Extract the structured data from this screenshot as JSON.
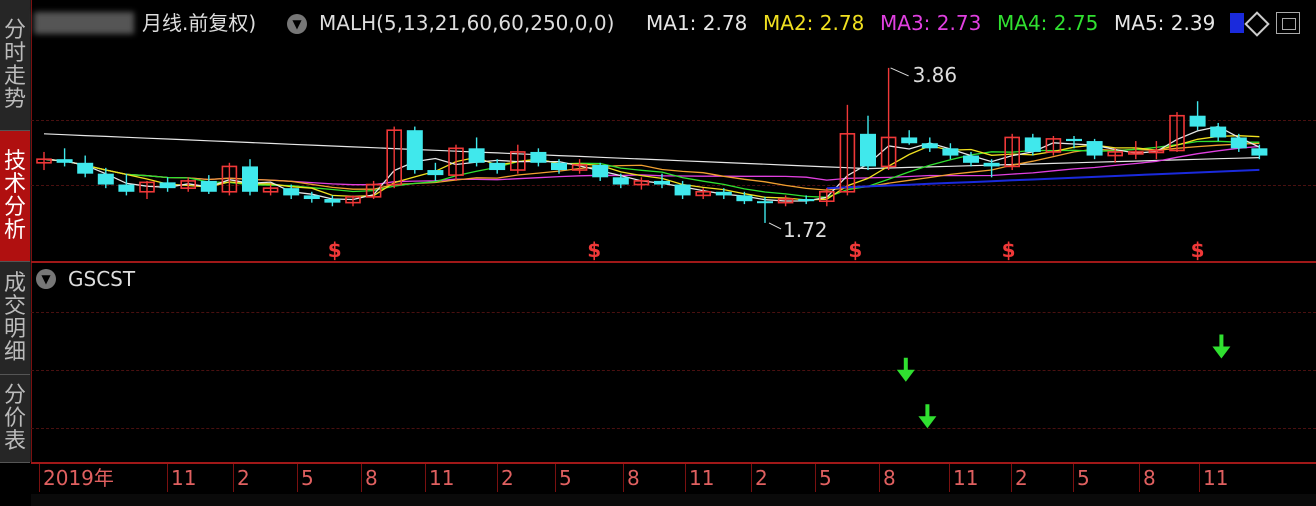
{
  "side_tabs": [
    {
      "label": "分时走势",
      "active": false
    },
    {
      "label": "技术分析",
      "active": true
    },
    {
      "label": "成交明细",
      "active": false
    },
    {
      "label": "分价表",
      "active": false
    }
  ],
  "header": {
    "period_label": "月线.前复权)",
    "indicator_params": "MALH(5,13,21,60,60,250,0,0)",
    "ma1": "MA1: 2.78",
    "ma2": "MA2: 2.78",
    "ma3": "MA3: 2.73",
    "ma4": "MA4: 2.75",
    "ma5": "MA5: 2.39"
  },
  "colors": {
    "up": "#f03838",
    "down": "#40e8ec",
    "ma1": "#e6e6e6",
    "ma2": "#f0e020",
    "ma3": "#e040e0",
    "ma4": "#30e030",
    "ma5": "#e6e6e6",
    "ma_blue": "#1a2adc",
    "ma_orange": "#f0a030",
    "signal": "#30e030"
  },
  "price_chart": {
    "high_label": "3.86",
    "low_label": "1.72",
    "signal_mark": "$"
  },
  "sub_chart": {
    "title": "GSCST"
  },
  "time_axis": {
    "labels": [
      "2019年",
      "11",
      "2",
      "5",
      "8",
      "11",
      "2",
      "5",
      "8",
      "11",
      "2",
      "5",
      "8",
      "11",
      "2",
      "5",
      "8",
      "11"
    ]
  },
  "chart_data": {
    "type": "candlestick",
    "ohlc": [
      [
        2.55,
        2.7,
        2.45,
        2.6
      ],
      [
        2.6,
        2.75,
        2.5,
        2.55
      ],
      [
        2.55,
        2.65,
        2.35,
        2.4
      ],
      [
        2.4,
        2.48,
        2.2,
        2.25
      ],
      [
        2.25,
        2.4,
        2.1,
        2.15
      ],
      [
        2.15,
        2.3,
        2.05,
        2.28
      ],
      [
        2.28,
        2.35,
        2.15,
        2.2
      ],
      [
        2.2,
        2.35,
        2.15,
        2.3
      ],
      [
        2.3,
        2.38,
        2.12,
        2.15
      ],
      [
        2.15,
        2.55,
        2.1,
        2.5
      ],
      [
        2.5,
        2.6,
        2.1,
        2.15
      ],
      [
        2.15,
        2.25,
        2.1,
        2.2
      ],
      [
        2.2,
        2.25,
        2.05,
        2.1
      ],
      [
        2.1,
        2.15,
        2.0,
        2.05
      ],
      [
        2.05,
        2.1,
        1.95,
        2.0
      ],
      [
        2.0,
        2.1,
        1.95,
        2.08
      ],
      [
        2.08,
        2.3,
        2.05,
        2.25
      ],
      [
        2.25,
        3.05,
        2.2,
        3.0
      ],
      [
        3.0,
        3.05,
        2.4,
        2.45
      ],
      [
        2.45,
        2.55,
        2.3,
        2.38
      ],
      [
        2.38,
        2.8,
        2.3,
        2.75
      ],
      [
        2.75,
        2.9,
        2.5,
        2.55
      ],
      [
        2.55,
        2.6,
        2.4,
        2.45
      ],
      [
        2.45,
        2.8,
        2.4,
        2.7
      ],
      [
        2.7,
        2.75,
        2.5,
        2.55
      ],
      [
        2.55,
        2.6,
        2.4,
        2.45
      ],
      [
        2.45,
        2.6,
        2.4,
        2.52
      ],
      [
        2.52,
        2.55,
        2.3,
        2.35
      ],
      [
        2.35,
        2.4,
        2.2,
        2.25
      ],
      [
        2.25,
        2.35,
        2.18,
        2.3
      ],
      [
        2.3,
        2.4,
        2.2,
        2.25
      ],
      [
        2.25,
        2.3,
        2.05,
        2.1
      ],
      [
        2.1,
        2.2,
        2.05,
        2.15
      ],
      [
        2.15,
        2.2,
        2.05,
        2.1
      ],
      [
        2.1,
        2.15,
        1.98,
        2.02
      ],
      [
        2.02,
        2.08,
        1.72,
        2.0
      ],
      [
        2.0,
        2.1,
        1.95,
        2.05
      ],
      [
        2.05,
        2.1,
        1.98,
        2.02
      ],
      [
        2.02,
        2.2,
        1.95,
        2.15
      ],
      [
        2.15,
        3.35,
        2.1,
        2.95
      ],
      [
        2.95,
        3.2,
        2.45,
        2.5
      ],
      [
        2.5,
        3.86,
        2.45,
        2.9
      ],
      [
        2.9,
        3.0,
        2.8,
        2.82
      ],
      [
        2.82,
        2.9,
        2.7,
        2.75
      ],
      [
        2.75,
        2.82,
        2.6,
        2.65
      ],
      [
        2.65,
        2.7,
        2.5,
        2.55
      ],
      [
        2.55,
        2.6,
        2.35,
        2.5
      ],
      [
        2.5,
        2.95,
        2.45,
        2.9
      ],
      [
        2.9,
        2.95,
        2.65,
        2.7
      ],
      [
        2.7,
        2.92,
        2.65,
        2.88
      ],
      [
        2.88,
        2.92,
        2.75,
        2.85
      ],
      [
        2.85,
        2.88,
        2.6,
        2.65
      ],
      [
        2.65,
        2.75,
        2.55,
        2.7
      ],
      [
        2.7,
        2.85,
        2.6,
        2.7
      ],
      [
        2.7,
        2.85,
        2.6,
        2.72
      ],
      [
        2.72,
        3.25,
        2.7,
        3.2
      ],
      [
        3.2,
        3.4,
        3.0,
        3.05
      ],
      [
        3.05,
        3.1,
        2.85,
        2.9
      ],
      [
        2.9,
        2.95,
        2.7,
        2.75
      ],
      [
        2.75,
        2.8,
        2.6,
        2.65
      ]
    ],
    "signal_bars": [
      8,
      17,
      29,
      41,
      56
    ],
    "sub_arrows": [
      {
        "bar": 48,
        "level": 0.55
      },
      {
        "bar": 49,
        "level": 0.25
      },
      {
        "bar": 59,
        "level": 0.7
      }
    ]
  }
}
